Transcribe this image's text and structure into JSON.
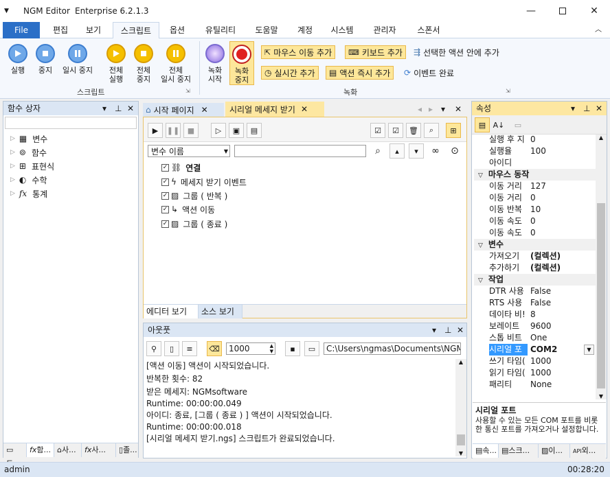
{
  "app": {
    "menu_glyph": "▼",
    "name": "NGM Editor",
    "edition": "Enterprise 6.2.1.3"
  },
  "menu": {
    "file": "File",
    "tabs": [
      "편집",
      "보기",
      "스크립트",
      "옵션",
      "유틸리티",
      "도움말",
      "계정",
      "시스템",
      "관리자",
      "스폰서"
    ]
  },
  "ribbon": {
    "script": {
      "run": "실행",
      "stop": "중지",
      "pause": "일시 중지",
      "run_all_1": "전체",
      "run_all_2": "실행",
      "stop_all_1": "전체",
      "stop_all_2": "중지",
      "pause_all_1": "전체",
      "pause_all_2": "일시 중지",
      "group": "스크립트"
    },
    "record": {
      "start_1": "녹화",
      "start_2": "시작",
      "stop_1": "녹화",
      "stop_2": "중지",
      "mouse": "마우스 이동 추가",
      "keyboard": "키보드 추가",
      "in_action": "선택한 액션 안에 추가",
      "realtime": "실시간 추가",
      "instant": "액션 즉시 추가",
      "event_done": "이벤트 완료",
      "group": "녹화"
    }
  },
  "left_panel": {
    "title": "함수 상자",
    "items": [
      "변수",
      "함수",
      "표현식",
      "수학",
      "통계"
    ],
    "bottom_tabs": [
      "도...",
      "함...",
      "사...",
      "사...",
      "졸..."
    ]
  },
  "editor": {
    "tabs": [
      "시작 페이지",
      "시리얼 메세지 받기"
    ],
    "filter_select": "변수 이름",
    "filter_input": "",
    "actions": [
      "연결",
      "메세지 받기 이벤트",
      "그룹 ( 반복 )",
      "액션 이동",
      "그룹 ( 종료 )"
    ],
    "bottom_tabs": [
      "에디터 보기",
      "소스 보기"
    ]
  },
  "output": {
    "title": "아웃풋",
    "count": "1000",
    "path": "C:\\Users\\ngmas\\Documents\\NGM6\\",
    "lines": [
      "[액션 이동] 액션이 시작되었습니다.",
      "반복한 횟수: 82",
      "받은 메세지: NGMsoftware",
      "Runtime: 00:00:00.049",
      "아이디: 종료, [그룹 ( 종료 ) ] 액션이 시작되었습니다.",
      "Runtime: 00:00:00.018",
      "[시리얼 메세지 받기.ngs] 스크립트가 완료되었습니다."
    ]
  },
  "props": {
    "title": "속성",
    "top_rows": [
      {
        "k": "실행 후 지",
        "v": "0"
      },
      {
        "k": "실행율",
        "v": "100"
      },
      {
        "k": "아이디",
        "v": ""
      }
    ],
    "cat_mouse": "마우스 동작",
    "mouse_rows": [
      {
        "k": "이동 거리",
        "v": "127"
      },
      {
        "k": "이동 거리",
        "v": "0"
      },
      {
        "k": "이동 반복",
        "v": "10"
      },
      {
        "k": "이동 속도",
        "v": "0"
      },
      {
        "k": "이동 속도",
        "v": "0"
      }
    ],
    "cat_var": "변수",
    "var_rows": [
      {
        "k": "가져오기",
        "v": "(컬렉션)"
      },
      {
        "k": "추가하기",
        "v": "(컬렉션)"
      }
    ],
    "cat_job": "작업",
    "job_rows": [
      {
        "k": "DTR 사용",
        "v": "False"
      },
      {
        "k": "RTS 사용",
        "v": "False"
      },
      {
        "k": "데이타 비!",
        "v": "8"
      },
      {
        "k": "보레이트",
        "v": "9600"
      },
      {
        "k": "스톱 비트",
        "v": "One"
      },
      {
        "k": "시리얼 포",
        "v": "COM2"
      },
      {
        "k": "쓰기 타임(",
        "v": "1000"
      },
      {
        "k": "읽기 타임(",
        "v": "1000"
      },
      {
        "k": "패리티",
        "v": "None"
      }
    ],
    "desc_title": "시리얼 포트",
    "desc_text": "사용할 수 있는 모든 COM 포트를 비롯한 통신 포트를 가져오거나 설정합니다.",
    "bottom_tabs": [
      "속...",
      "스크...",
      "이...",
      "외..."
    ]
  },
  "status": {
    "user": "admin",
    "time": "00:28:20"
  },
  "colors": {
    "accent": "#2b6fc7",
    "highlight": "#fde79a",
    "selection": "#3399ff"
  }
}
